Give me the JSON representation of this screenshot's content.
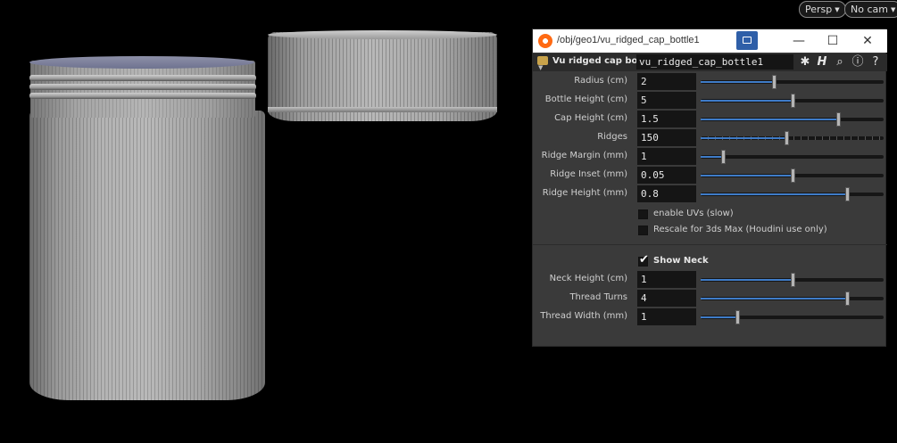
{
  "viewport": {
    "camera_menu": "Persp",
    "cam_menu": "No cam"
  },
  "window": {
    "title": "/obj/geo1/vu_ridged_cap_bottle1",
    "pin_icon": "window-pin-icon",
    "minimize": "—",
    "maximize": "☐",
    "close": "✕"
  },
  "node": {
    "type_label": "Vu ridged cap bottle",
    "name": "vu_ridged_cap_bottle1"
  },
  "params": [
    {
      "label": "Radius (cm)",
      "value": "2",
      "fraction": 0.4
    },
    {
      "label": "Bottle Height (cm)",
      "value": "5",
      "fraction": 0.5
    },
    {
      "label": "Cap Height (cm)",
      "value": "1.5",
      "fraction": 0.75
    },
    {
      "label": "Ridges",
      "value": "150",
      "fraction": 0.47
    },
    {
      "label": "Ridge Margin (mm)",
      "value": "1",
      "fraction": 0.12
    },
    {
      "label": "Ridge Inset (mm)",
      "value": "0.05",
      "fraction": 0.5
    },
    {
      "label": "Ridge Height (mm)",
      "value": "0.8",
      "fraction": 0.8
    }
  ],
  "checkboxes": [
    {
      "label": "enable UVs (slow)",
      "checked": false
    },
    {
      "label": "Rescale for 3ds Max (Houdini use only)",
      "checked": false
    }
  ],
  "neck": {
    "show_neck_label": "Show Neck",
    "show_neck_checked": true,
    "params": [
      {
        "label": "Neck Height (cm)",
        "value": "1",
        "fraction": 0.5
      },
      {
        "label": "Thread Turns",
        "value": "4",
        "fraction": 0.8
      },
      {
        "label": "Thread Width (mm)",
        "value": "1",
        "fraction": 0.2
      }
    ]
  },
  "colors": {
    "slider_fill": "#3f7cc8",
    "pin_button": "#2f5fa8",
    "panel_bg": "#3a3a3a"
  }
}
